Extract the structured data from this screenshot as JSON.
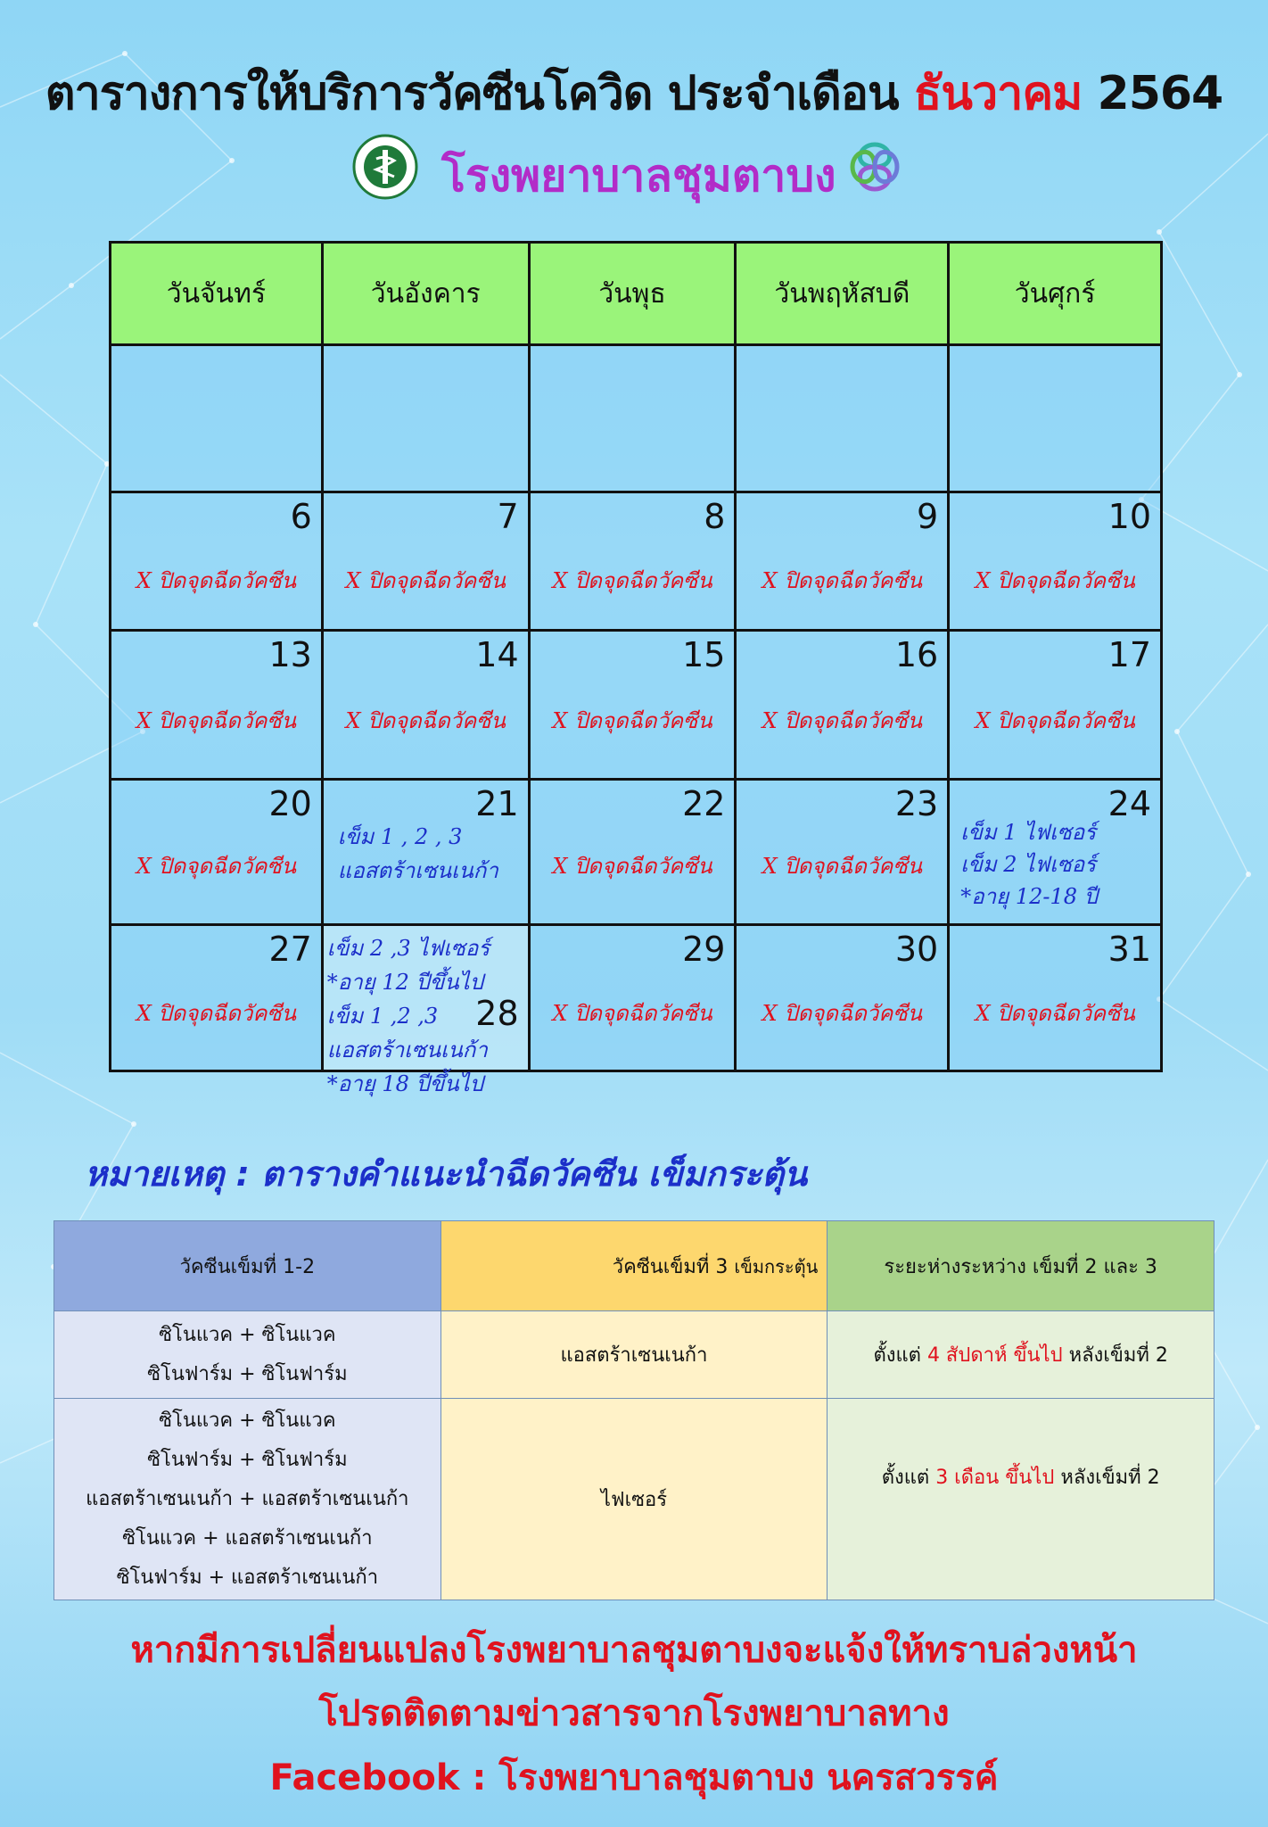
{
  "title": {
    "prefix": "ตารางการให้บริการวัคซีนโควิด ประจำเดือน",
    "month": "ธันวาคม",
    "year": "2564"
  },
  "hospital_name": "โรงพยาบาลชุมตาบง",
  "colors": {
    "header_green": "#9af47a",
    "red": "#e0121e",
    "blue": "#1b2fc9",
    "purple": "#b22cc8"
  },
  "calendar": {
    "weekdays": [
      "วันจันทร์",
      "วันอังคาร",
      "วันพุธ",
      "วันพฤหัสบดี",
      "วันศุกร์"
    ],
    "closed_label": "X ปิดจุดฉีดวัคซีน",
    "weeks": [
      {
        "days": [
          "",
          "",
          "",
          "",
          ""
        ]
      },
      {
        "days": [
          "6",
          "7",
          "8",
          "9",
          "10"
        ]
      },
      {
        "days": [
          "13",
          "14",
          "15",
          "16",
          "17"
        ]
      },
      {
        "days": [
          "20",
          "21",
          "22",
          "23",
          "24"
        ]
      },
      {
        "days": [
          "27",
          "28",
          "29",
          "30",
          "31"
        ]
      }
    ],
    "open_days": {
      "d21": [
        "เข็ม 1 , 2 , 3",
        "แอสตร้าเซนเนก้า"
      ],
      "d24": [
        "เข็ม 1 ไฟเซอร์",
        "เข็ม 2 ไฟเซอร์",
        "*อายุ 12-18 ปี"
      ],
      "d28": [
        "เข็ม 2 ,3 ไฟเซอร์",
        "*อายุ 12 ปีขึ้นไป",
        "เข็ม 1 ,2 ,3",
        "แอสตร้าเซนเนก้า",
        "*อายุ 18 ปีขึ้นไป"
      ]
    }
  },
  "note_title": "หมายเหตุ : ตารางคำแนะนำฉีดวัคซีน เข็มกระตุ้น",
  "guide": {
    "headers": [
      "วัคซีนเข็มที่ 1-2",
      "วัคซีนเข็มที่ 3",
      "เข็มกระตุ้น",
      "ระยะห่างระหว่าง เข็มที่ 2 และ 3"
    ],
    "rows": [
      {
        "first": [
          "ซิโนแวค + ซิโนแวค",
          "ซิโนฟาร์ม + ซิโนฟาร์ม"
        ],
        "third": "แอสตร้าเซนเนก้า",
        "gap_prefix": "ตั้งแต่",
        "gap_value": "4 สัปดาห์ ขึ้นไป",
        "gap_suffix": "หลังเข็มที่ 2"
      },
      {
        "first": [
          "ซิโนแวค + ซิโนแวค",
          "ซิโนฟาร์ม + ซิโนฟาร์ม",
          "แอสตร้าเซนเนก้า + แอสตร้าเซนเนก้า",
          "ซิโนแวค + แอสตร้าเซนเนก้า",
          "ซิโนฟาร์ม + แอสตร้าเซนเนก้า"
        ],
        "third": "ไฟเซอร์",
        "gap_prefix": "ตั้งแต่",
        "gap_value": "3 เดือน ขึ้นไป",
        "gap_suffix": "หลังเข็มที่ 2"
      }
    ]
  },
  "footer": [
    "หากมีการเปลี่ยนแปลงโรงพยาบาลชุมตาบงจะแจ้งให้ทราบล่วงหน้า",
    "โปรดติดตามข่าวสารจากโรงพยาบาลทาง",
    "Facebook : โรงพยาบาลชุมตาบง นครสวรรค์"
  ]
}
